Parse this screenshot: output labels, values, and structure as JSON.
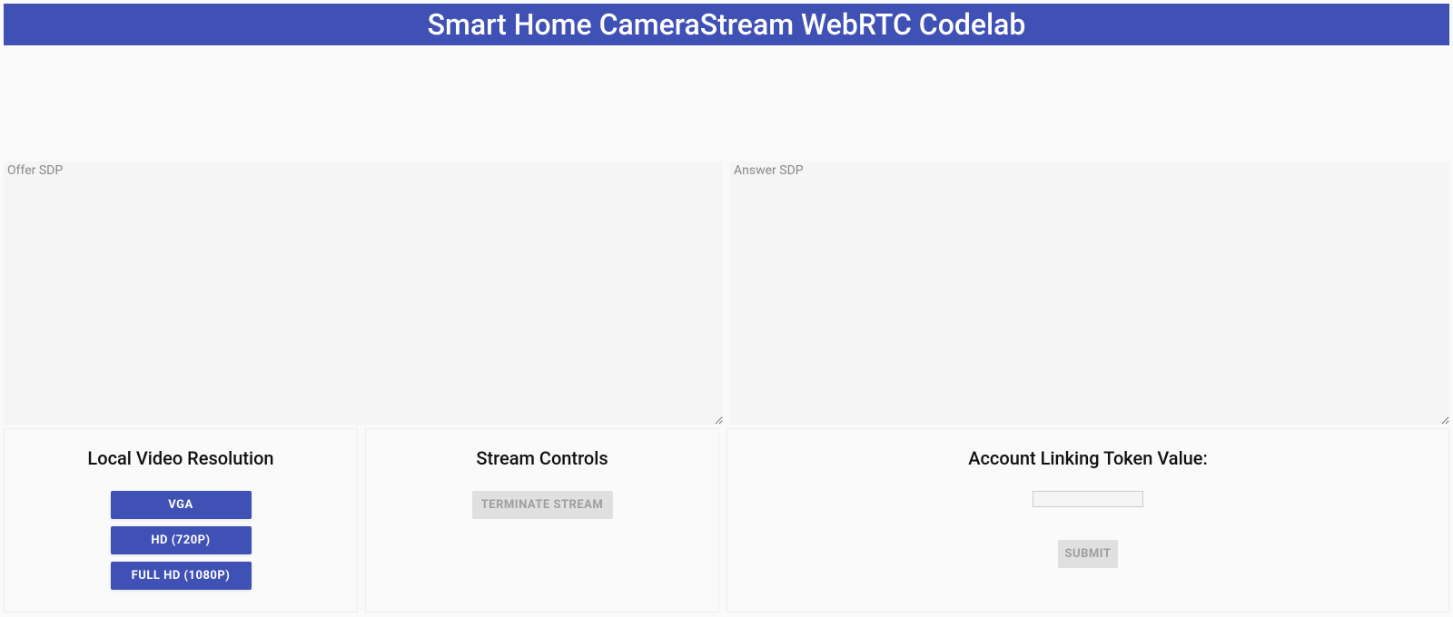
{
  "header": {
    "title": "Smart Home CameraStream WebRTC Codelab"
  },
  "sdp": {
    "offer_placeholder": "Offer SDP",
    "offer_value": "",
    "answer_placeholder": "Answer SDP",
    "answer_value": ""
  },
  "resolution": {
    "heading": "Local Video Resolution",
    "buttons": [
      {
        "label": "VGA"
      },
      {
        "label": "HD (720P)"
      },
      {
        "label": "FULL HD (1080P)"
      }
    ]
  },
  "stream": {
    "heading": "Stream Controls",
    "terminate_label": "TERMINATE STREAM"
  },
  "token": {
    "heading": "Account Linking Token Value:",
    "input_value": "",
    "submit_label": "SUBMIT"
  }
}
